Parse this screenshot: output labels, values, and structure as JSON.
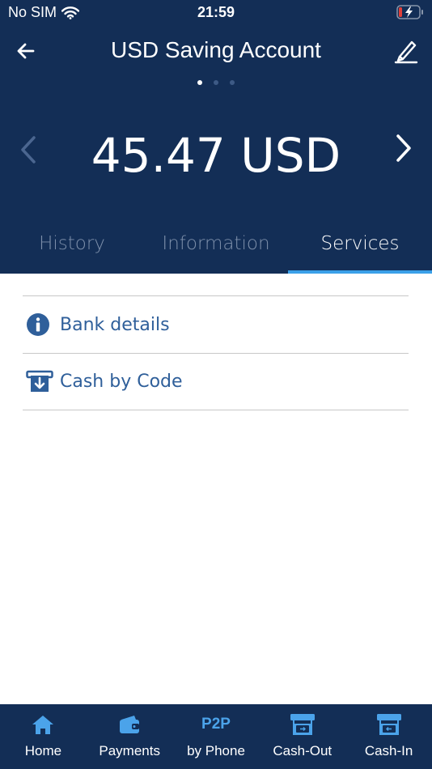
{
  "status_bar": {
    "carrier": "No SIM",
    "time": "21:59"
  },
  "header": {
    "title": "USD Saving Account",
    "page_count": 3,
    "active_page": 0
  },
  "balance": {
    "display": "45.47 USD"
  },
  "tabs": [
    {
      "label": "History",
      "active": false
    },
    {
      "label": "Information",
      "active": false
    },
    {
      "label": "Services",
      "active": true
    }
  ],
  "services": [
    {
      "label": "Bank details",
      "icon": "info-icon"
    },
    {
      "label": "Cash by Code",
      "icon": "cash-by-code-icon"
    }
  ],
  "bottom_nav": [
    {
      "label": "Home",
      "icon": "home-icon"
    },
    {
      "label": "Payments",
      "icon": "wallet-icon"
    },
    {
      "label": "by Phone",
      "icon": "p2p-icon",
      "icon_text": "P2P"
    },
    {
      "label": "Cash-Out",
      "icon": "atm-icon"
    },
    {
      "label": "Cash-In",
      "icon": "atm-icon"
    }
  ],
  "colors": {
    "header_bg": "#132e56",
    "accent": "#3ba0e8",
    "link": "#2f5f9a",
    "battery_low": "#e0403a"
  }
}
